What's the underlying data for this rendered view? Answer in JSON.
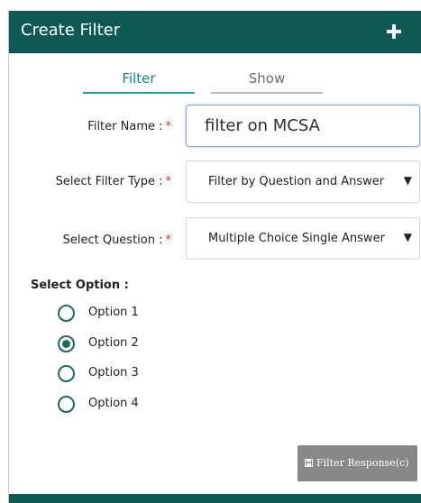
{
  "header": {
    "title": "Create Filter"
  },
  "tabs": [
    {
      "label": "Filter",
      "active": true
    },
    {
      "label": "Show",
      "active": false
    }
  ],
  "form": {
    "filter_name_label": "Filter Name :",
    "filter_name_value": "filter on MCSA",
    "filter_type_label": "Select Filter Type :",
    "filter_type_value": "Filter by Question and Answer",
    "question_label": "Select Question :",
    "question_value": "Multiple Choice Single Answer",
    "required_mark": "*",
    "caret": "▼"
  },
  "options": {
    "label": "Select Option :",
    "items": [
      {
        "label": "Option 1",
        "selected": false
      },
      {
        "label": "Option 2",
        "selected": true
      },
      {
        "label": "Option 3",
        "selected": false
      },
      {
        "label": "Option 4",
        "selected": false
      }
    ]
  },
  "actions": {
    "filter_response_label": "Filter Response(c)"
  },
  "colors": {
    "header_bg": "#0e5a52",
    "accent": "#1ca8a0",
    "required": "#e52a2a",
    "button_bg": "#888888"
  }
}
